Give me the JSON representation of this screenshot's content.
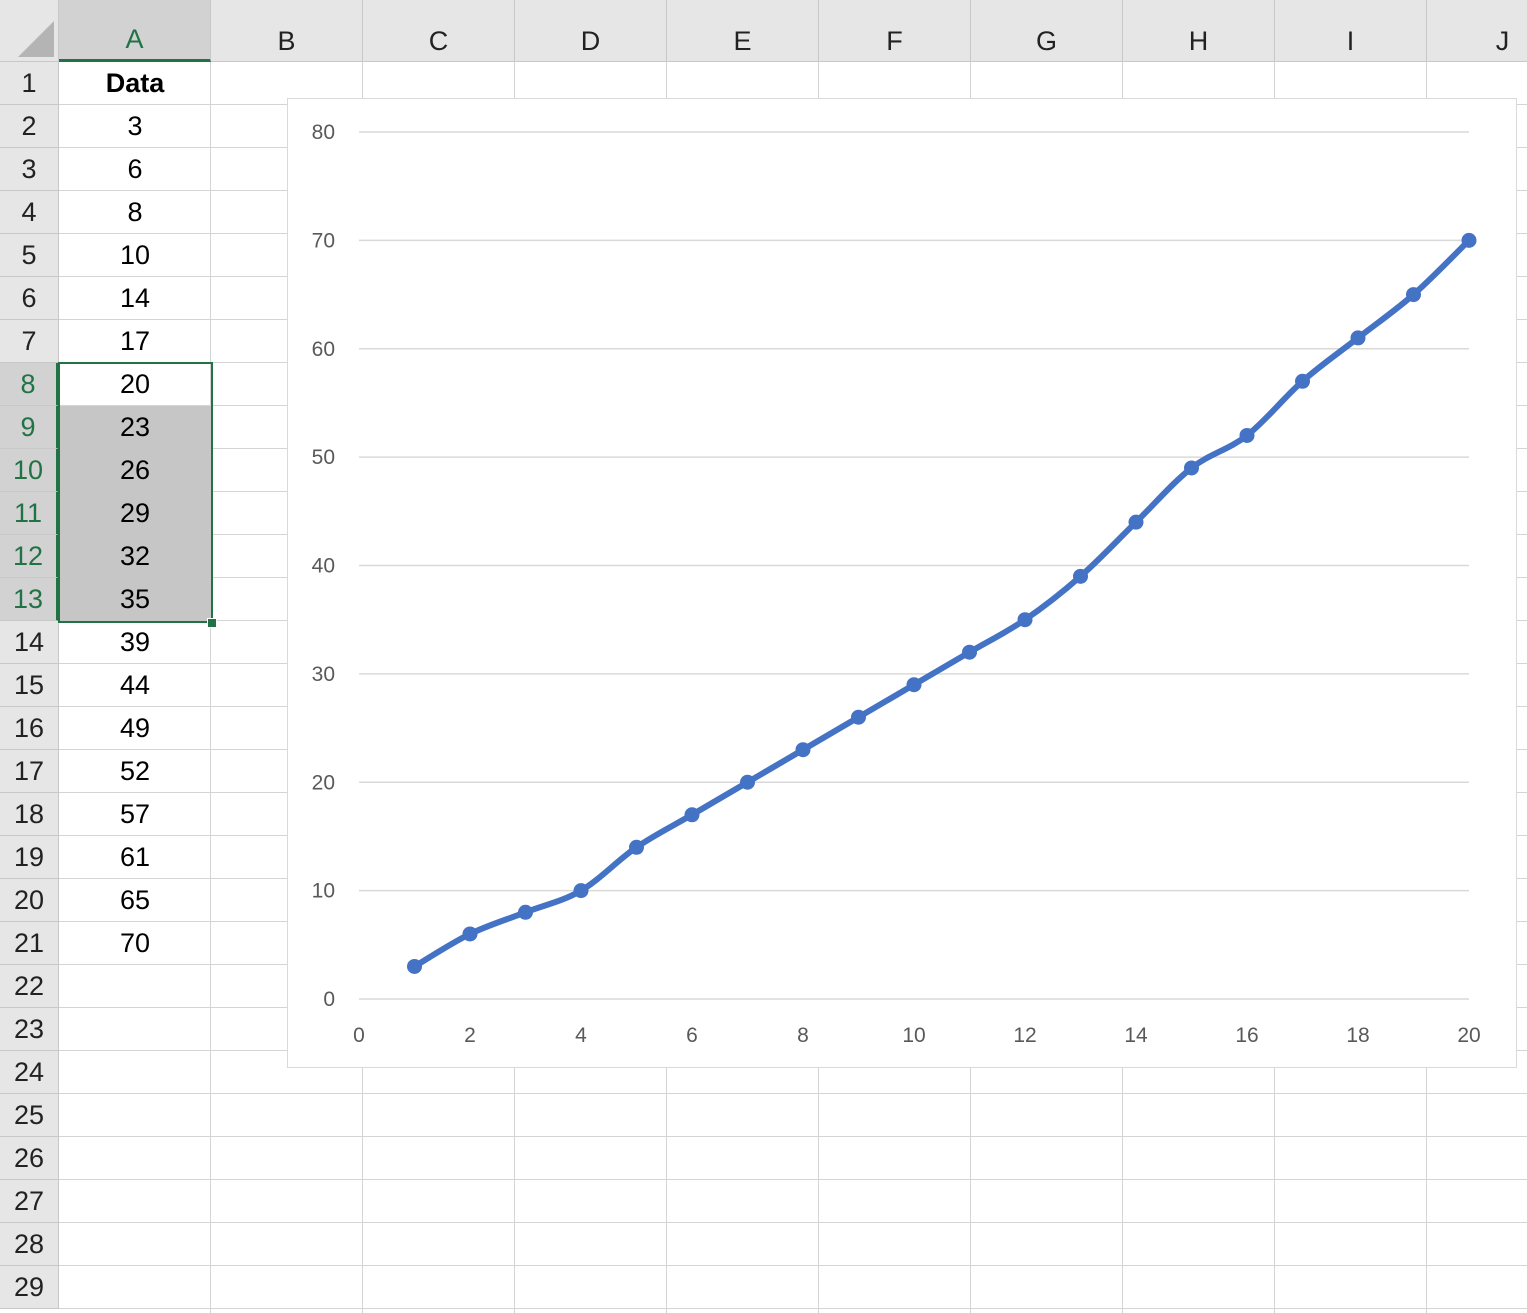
{
  "sheet": {
    "columns": [
      "A",
      "B",
      "C",
      "D",
      "E",
      "F",
      "G",
      "H",
      "I",
      "J"
    ],
    "rows": [
      "1",
      "2",
      "3",
      "4",
      "5",
      "6",
      "7",
      "8",
      "9",
      "10",
      "11",
      "12",
      "13",
      "14",
      "15",
      "16",
      "17",
      "18",
      "19",
      "20",
      "21",
      "22",
      "23",
      "24",
      "25",
      "26",
      "27",
      "28",
      "29"
    ],
    "column_a": [
      "Data",
      "3",
      "6",
      "8",
      "10",
      "14",
      "17",
      "20",
      "23",
      "26",
      "29",
      "32",
      "35",
      "39",
      "44",
      "49",
      "52",
      "57",
      "61",
      "65",
      "70"
    ],
    "selection": "A8:A13",
    "accent_color": "#217346"
  },
  "chart_data": {
    "type": "line",
    "x": [
      1,
      2,
      3,
      4,
      5,
      6,
      7,
      8,
      9,
      10,
      11,
      12,
      13,
      14,
      15,
      16,
      17,
      18,
      19,
      20
    ],
    "series": [
      {
        "values": [
          3,
          6,
          8,
          10,
          14,
          17,
          20,
          23,
          26,
          29,
          32,
          35,
          39,
          44,
          49,
          52,
          57,
          61,
          65,
          70
        ],
        "color": "#4472c4"
      }
    ],
    "x_ticks": [
      "0",
      "2",
      "4",
      "6",
      "8",
      "10",
      "12",
      "14",
      "16",
      "18",
      "20"
    ],
    "y_ticks": [
      "0",
      "10",
      "20",
      "30",
      "40",
      "50",
      "60",
      "70",
      "80"
    ],
    "xlim": [
      0,
      20
    ],
    "ylim": [
      0,
      80
    ],
    "grid": "horizontal",
    "markers": true,
    "smooth": true
  }
}
